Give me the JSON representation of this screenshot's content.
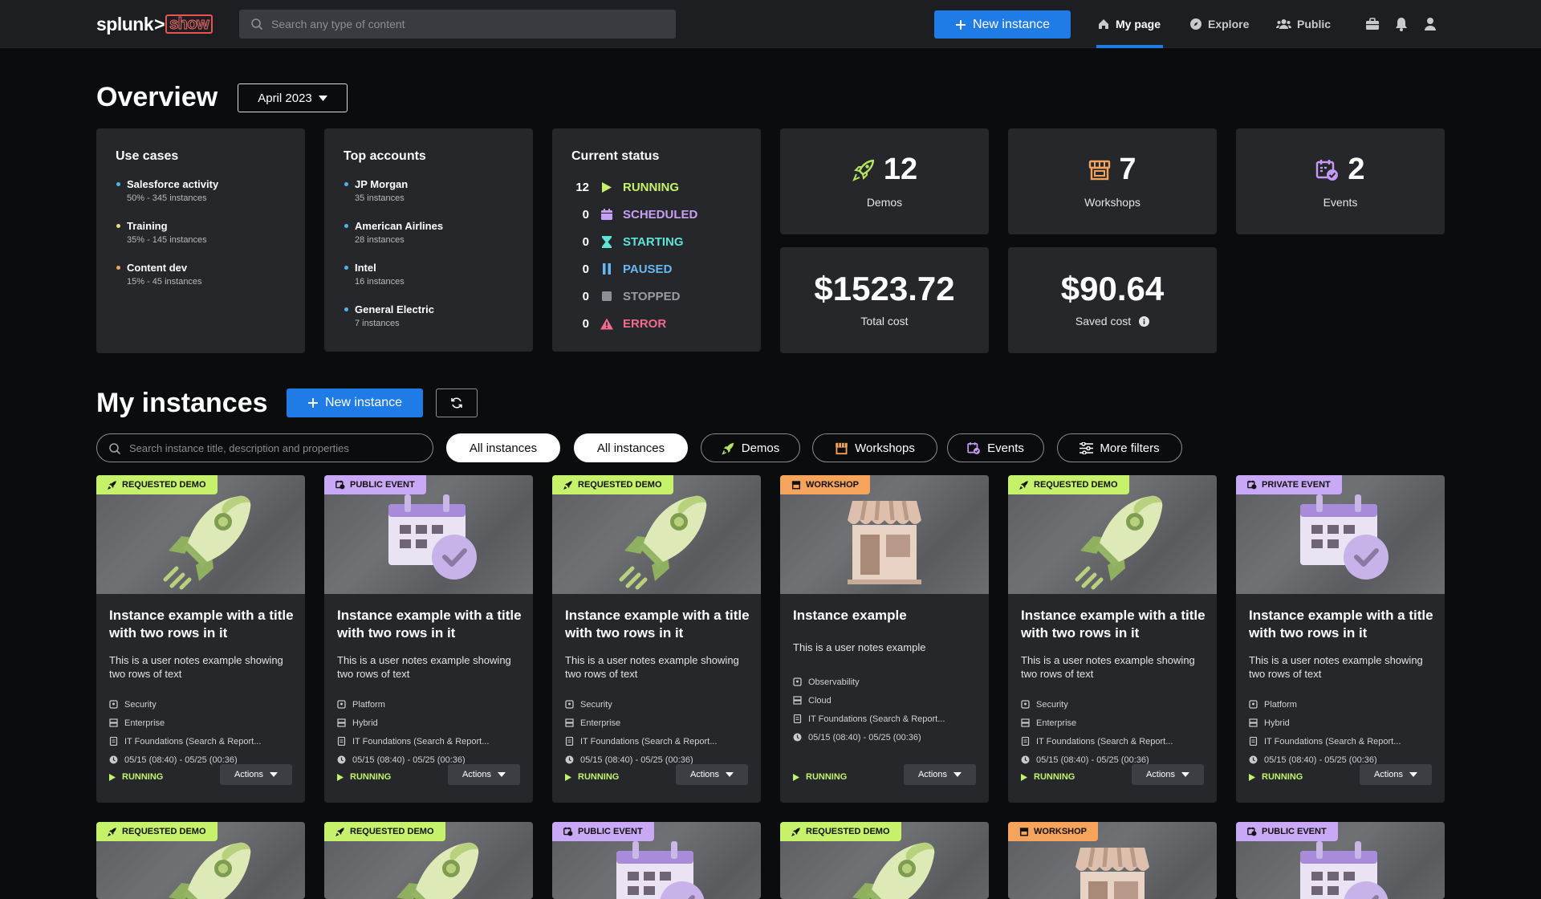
{
  "topbar": {
    "logo_main": "splunk",
    "logo_gt": ">",
    "logo_show": "show",
    "search_placeholder": "Search any type of content",
    "new_instance": "New instance",
    "nav": [
      {
        "label": "My page",
        "icon": "home-icon",
        "active": true
      },
      {
        "label": "Explore",
        "icon": "compass-icon",
        "active": false
      },
      {
        "label": "Public",
        "icon": "people-icon",
        "active": false
      }
    ]
  },
  "overview": {
    "title": "Overview",
    "month": "April 2023",
    "use_cases": {
      "title": "Use cases",
      "items": [
        {
          "name": "Salesforce activity",
          "sub": "50% - 345 instances",
          "color": "#4fb5e8"
        },
        {
          "name": "Training",
          "sub": "35% - 145 instances",
          "color": "#e8e07a"
        },
        {
          "name": "Content dev",
          "sub": "15% - 45 instances",
          "color": "#f0a35e"
        }
      ]
    },
    "top_accounts": {
      "title": "Top accounts",
      "items": [
        {
          "name": "JP Morgan",
          "sub": "35 instances"
        },
        {
          "name": "American Airlines",
          "sub": "28 instances"
        },
        {
          "name": "Intel",
          "sub": "16 instances"
        },
        {
          "name": "General Electric",
          "sub": "7 instances"
        }
      ]
    },
    "current_status": {
      "title": "Current status",
      "rows": [
        {
          "count": "12",
          "label": "RUNNING",
          "color": "#c5f26a"
        },
        {
          "count": "0",
          "label": "SCHEDULED",
          "color": "#c6a0f3"
        },
        {
          "count": "0",
          "label": "STARTING",
          "color": "#5fe3d6"
        },
        {
          "count": "0",
          "label": "PAUSED",
          "color": "#66b8f2"
        },
        {
          "count": "0",
          "label": "STOPPED",
          "color": "#9a9ba0"
        },
        {
          "count": "0",
          "label": "ERROR",
          "color": "#f26a8d"
        }
      ]
    },
    "stats": {
      "demos": {
        "value": "12",
        "label": "Demos"
      },
      "workshops": {
        "value": "7",
        "label": "Workshops"
      },
      "events": {
        "value": "2",
        "label": "Events"
      },
      "total_cost": {
        "value": "$1523.72",
        "label": "Total cost"
      },
      "saved_cost": {
        "value": "$90.64",
        "label": "Saved cost"
      }
    }
  },
  "instances": {
    "title": "My instances",
    "new_instance": "New instance",
    "search_placeholder": "Search instance title, description and properties",
    "filters": {
      "all1": "All instances",
      "all2": "All instances",
      "demos": "Demos",
      "workshops": "Workshops",
      "events": "Events",
      "more": "More filters"
    },
    "cards": [
      {
        "badge": "REQUESTED DEMO",
        "kind": "demo",
        "title": "Instance example with a title with two rows in it",
        "notes": "This is a user notes example showing two rows of text",
        "props": [
          "Security",
          "Enterprise",
          "IT Foundations (Search & Report...",
          "05/15 (08:40) - 05/25 (00:36)"
        ],
        "status": "RUNNING",
        "actions": "Actions"
      },
      {
        "badge": "PUBLIC EVENT",
        "kind": "event",
        "title": "Instance example with a title with two rows in it",
        "notes": "This is a user notes example showing two rows of text",
        "props": [
          "Platform",
          "Hybrid",
          "IT Foundations (Search & Report...",
          "05/15 (08:40) - 05/25 (00:36)"
        ],
        "status": "RUNNING",
        "actions": "Actions"
      },
      {
        "badge": "REQUESTED DEMO",
        "kind": "demo",
        "title": "Instance example with a title with two rows in it",
        "notes": "This is a user notes example showing two rows of text",
        "props": [
          "Security",
          "Enterprise",
          "IT Foundations (Search & Report...",
          "05/15 (08:40) - 05/25 (00:36)"
        ],
        "status": "RUNNING",
        "actions": "Actions"
      },
      {
        "badge": "WORKSHOP",
        "kind": "workshop",
        "title": "Instance example",
        "notes": "This is a user notes example",
        "props": [
          "Observability",
          "Cloud",
          "IT Foundations (Search & Report...",
          "05/15 (08:40) - 05/25 (00:36)"
        ],
        "status": "RUNNING",
        "actions": "Actions"
      },
      {
        "badge": "REQUESTED DEMO",
        "kind": "demo",
        "title": "Instance example with a title with two rows in it",
        "notes": "This is a user notes example showing two rows of text",
        "props": [
          "Security",
          "Enterprise",
          "IT Foundations (Search & Report...",
          "05/15 (08:40) - 05/25 (00:36)"
        ],
        "status": "RUNNING",
        "actions": "Actions"
      },
      {
        "badge": "PRIVATE EVENT",
        "kind": "event",
        "title": "Instance example with a title with two rows in it",
        "notes": "This is a user notes example showing two rows of text",
        "props": [
          "Platform",
          "Hybrid",
          "IT Foundations (Search & Report...",
          "05/15 (08:40) - 05/25 (00:36)"
        ],
        "status": "RUNNING",
        "actions": "Actions"
      }
    ],
    "cards_row2": [
      {
        "badge": "REQUESTED DEMO",
        "kind": "demo"
      },
      {
        "badge": "REQUESTED DEMO",
        "kind": "demo"
      },
      {
        "badge": "PUBLIC EVENT",
        "kind": "event"
      },
      {
        "badge": "REQUESTED DEMO",
        "kind": "demo"
      },
      {
        "badge": "WORKSHOP",
        "kind": "workshop"
      },
      {
        "badge": "PUBLIC EVENT",
        "kind": "event"
      }
    ]
  },
  "colors": {
    "accent": "#1f7be6",
    "demo_badge": "#c5f26a",
    "event_badge": "#c9a8f5",
    "workshop_badge": "#f6a35b",
    "running": "#c3f26e"
  }
}
